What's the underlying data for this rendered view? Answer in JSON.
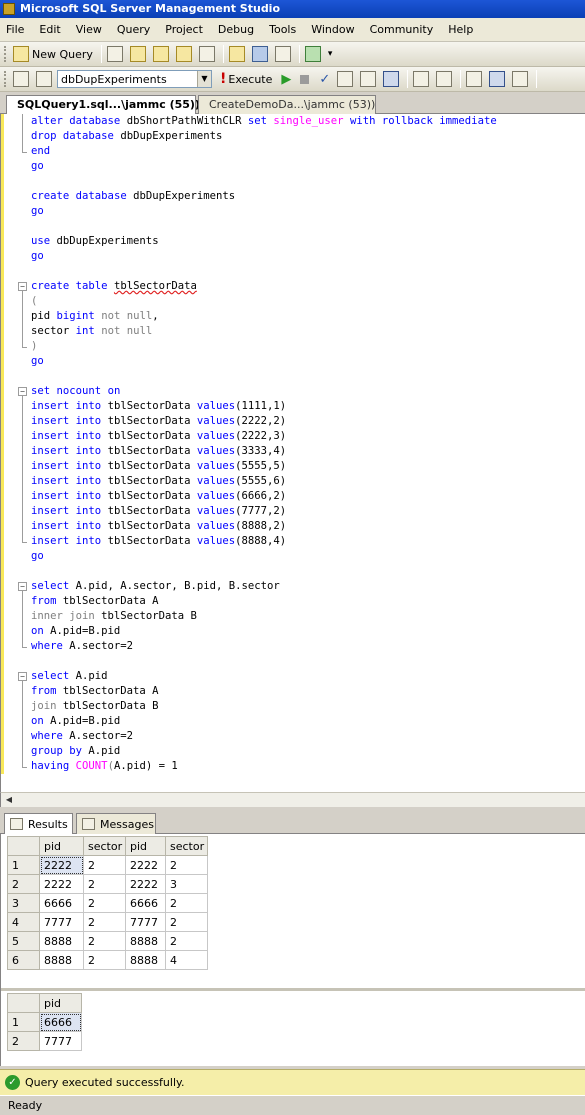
{
  "window": {
    "title": "Microsoft SQL Server Management Studio"
  },
  "menu": [
    "File",
    "Edit",
    "View",
    "Query",
    "Project",
    "Debug",
    "Tools",
    "Window",
    "Community",
    "Help"
  ],
  "toolbar": {
    "new_query_label": "New Query",
    "database": "dbDupExperiments",
    "execute_label": "Execute"
  },
  "tabs": [
    {
      "label": "SQLQuery1.sql...\\jammc (55))*",
      "active": true
    },
    {
      "label": "CreateDemoDa...\\jammc (53))",
      "active": false
    }
  ],
  "editor": {
    "lines": [
      "alter database dbShortPathWithCLR set single_user with rollback immediate",
      "drop database dbDupExperiments",
      "end",
      "go",
      "",
      "create database dbDupExperiments",
      "go",
      "",
      "use dbDupExperiments",
      "go",
      "",
      "create table tblSectorData",
      "(",
      "pid bigint not null,",
      "sector int not null",
      ")",
      "go",
      "",
      "set nocount on",
      "insert into tblSectorData values(1111,1)",
      "insert into tblSectorData values(2222,2)",
      "insert into tblSectorData values(2222,3)",
      "insert into tblSectorData values(3333,4)",
      "insert into tblSectorData values(5555,5)",
      "insert into tblSectorData values(5555,6)",
      "insert into tblSectorData values(6666,2)",
      "insert into tblSectorData values(7777,2)",
      "insert into tblSectorData values(8888,2)",
      "insert into tblSectorData values(8888,4)",
      "go",
      "",
      "select A.pid, A.sector, B.pid, B.sector",
      "from tblSectorData A",
      "inner join tblSectorData B",
      "on A.pid=B.pid",
      "where A.sector=2",
      "",
      "select A.pid",
      "from tblSectorData A",
      "join tblSectorData B",
      "on A.pid=B.pid",
      "where A.sector=2",
      "group by A.pid",
      "having COUNT(A.pid) = 1"
    ]
  },
  "results_tabs": {
    "results": "Results",
    "messages": "Messages"
  },
  "result1": {
    "columns": [
      "pid",
      "sector",
      "pid",
      "sector"
    ],
    "rows": [
      {
        "n": "1",
        "cells": [
          "2222",
          "2",
          "2222",
          "2"
        ]
      },
      {
        "n": "2",
        "cells": [
          "2222",
          "2",
          "2222",
          "3"
        ]
      },
      {
        "n": "3",
        "cells": [
          "6666",
          "2",
          "6666",
          "2"
        ]
      },
      {
        "n": "4",
        "cells": [
          "7777",
          "2",
          "7777",
          "2"
        ]
      },
      {
        "n": "5",
        "cells": [
          "8888",
          "2",
          "8888",
          "2"
        ]
      },
      {
        "n": "6",
        "cells": [
          "8888",
          "2",
          "8888",
          "4"
        ]
      }
    ]
  },
  "result2": {
    "columns": [
      "pid"
    ],
    "rows": [
      {
        "n": "1",
        "cells": [
          "6666"
        ]
      },
      {
        "n": "2",
        "cells": [
          "7777"
        ]
      }
    ]
  },
  "status": {
    "message": "Query executed successfully.",
    "ready": "Ready"
  }
}
